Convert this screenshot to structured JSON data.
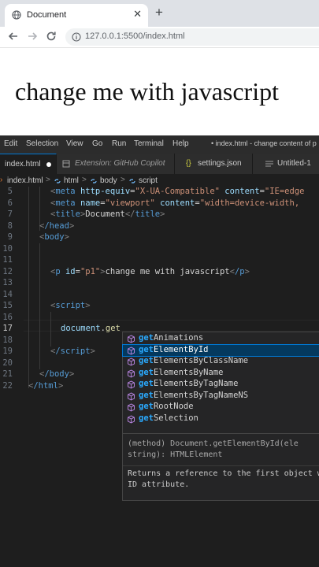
{
  "browser": {
    "tab_title": "Document",
    "tab_close": "✕",
    "new_tab": "+",
    "url": "127.0.0.1:5500/index.html",
    "page_text": "change me with javascript"
  },
  "vscode": {
    "menu": [
      "Edit",
      "Selection",
      "View",
      "Go",
      "Run",
      "Terminal",
      "Help"
    ],
    "window_title": "• index.html - change content of p",
    "tabs": [
      {
        "label": "index.html"
      },
      {
        "label": "Extension: GitHub Copilot"
      },
      {
        "label": "settings.json",
        "icon": "{}"
      },
      {
        "label": "Untitled-1"
      }
    ],
    "breadcrumb": {
      "file": "index.html",
      "sep": ">",
      "items": [
        "html",
        "body",
        "script"
      ]
    },
    "line_numbers": [
      "5",
      "6",
      "7",
      "8",
      "9",
      "10",
      "11",
      "12",
      "13",
      "14",
      "15",
      "16",
      "17",
      "18",
      "19",
      "20",
      "21",
      "22"
    ],
    "code": {
      "l5_indent": "      ",
      "l5_tag": "meta",
      "l5_attr1": "http-equiv",
      "l5_val1": "\"X-UA-Compatible\"",
      "l5_attr2": "content",
      "l5_val2": "\"IE=edge",
      "l6_tag": "meta",
      "l6_attr1": "name",
      "l6_val1": "\"viewport\"",
      "l6_attr2": "content",
      "l6_val2": "\"width=device-width,",
      "l7_tag": "title",
      "l7_text": "Document",
      "l8_tag": "/head",
      "l9_tag": "body",
      "l12_tag": "p",
      "l12_attr": "id",
      "l12_val": "\"p1\"",
      "l12_text": "change me with javascript",
      "l12_close": "/p",
      "l15_tag": "script",
      "l17_obj": "document",
      "l17_dot": ".",
      "l17_typed": "get",
      "l19_tag": "/script",
      "l21_tag": "/body",
      "l22_tag": "/html"
    },
    "suggestions": {
      "prefix": "get",
      "items": [
        "Animations",
        "ElementById",
        "ElementsByClassName",
        "ElementsByName",
        "ElementsByTagName",
        "ElementsByTagNameNS",
        "RootNode",
        "Selection"
      ],
      "selected": 1
    },
    "details": {
      "signature": "(method) Document.getElementById(ele\nstring): HTMLElement",
      "doc": "Returns a reference to the first object with the specif\nID attribute."
    }
  }
}
